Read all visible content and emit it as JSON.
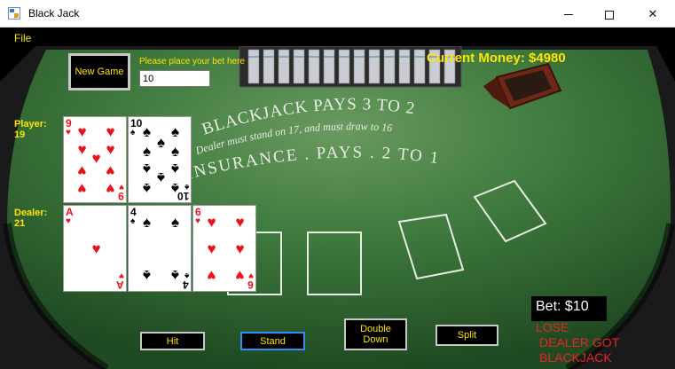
{
  "window": {
    "title": "Black Jack",
    "controls": {
      "minimize": "minimize",
      "maximize": "maximize",
      "close": "✕"
    }
  },
  "menu": {
    "items": [
      {
        "label": "File"
      }
    ]
  },
  "controls": {
    "new_game_label": "New Game",
    "bet_prompt": "Please place your bet here",
    "bet_input_value": "10",
    "current_money": "Current Money: $4980"
  },
  "player": {
    "label": "Player:",
    "score": "19",
    "cards": [
      {
        "rank": "9",
        "suit": "♥",
        "color": "red"
      },
      {
        "rank": "10",
        "suit": "♠",
        "color": "black"
      }
    ]
  },
  "dealer": {
    "label": "Dealer:",
    "score": "21",
    "cards": [
      {
        "rank": "A",
        "suit": "♥",
        "color": "red"
      },
      {
        "rank": "4",
        "suit": "♠",
        "color": "black"
      },
      {
        "rank": "6",
        "suit": "♥",
        "color": "red"
      }
    ]
  },
  "table_text": {
    "line1": "BLACKJACK PAYS 3 TO 2",
    "line2": "Dealer must stand on 17, and must draw to 16",
    "line3": "INSURANCE . PAYS . 2 TO 1"
  },
  "actions": {
    "hit": "Hit",
    "stand": "Stand",
    "double_line1": "Double",
    "double_line2": "Down",
    "split": "Split"
  },
  "status": {
    "bet": "Bet: $10",
    "result_line1": "LOSE",
    "result_line2": "DEALER GOT",
    "result_line3": "BLACKJACK"
  },
  "colors": {
    "accent_text": "#ffe400",
    "felt": "#3c7a3d",
    "result_red": "#e8242a",
    "focus_border": "#2f8fff"
  }
}
